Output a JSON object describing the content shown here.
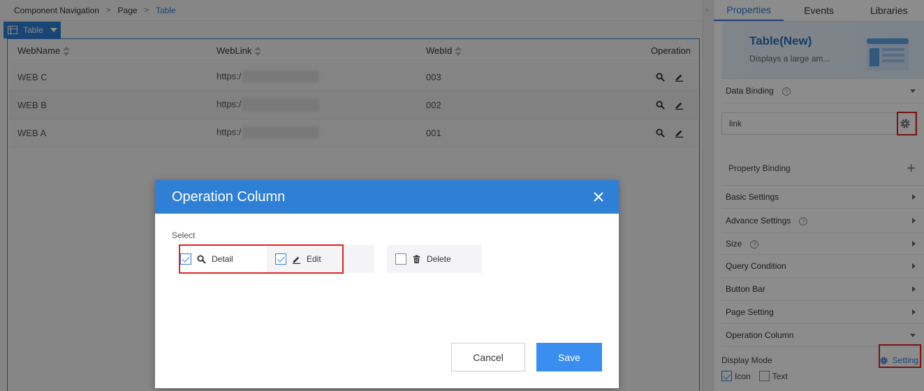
{
  "breadcrumb": {
    "items": [
      "Component Navigation",
      "Page"
    ],
    "current": "Table"
  },
  "canvas": {
    "tag_label": "Table",
    "columns": [
      "WebName",
      "WebLink",
      "WebId",
      "Operation"
    ],
    "rows": [
      {
        "name": "WEB C",
        "link": "https:/",
        "id": "003"
      },
      {
        "name": "WEB B",
        "link": "https:/",
        "id": "002"
      },
      {
        "name": "WEB A",
        "link": "https:/",
        "id": "001"
      }
    ]
  },
  "modal": {
    "title": "Operation Column",
    "select_label": "Select",
    "options": [
      {
        "label": "Detail",
        "checked": true,
        "icon": "search-icon"
      },
      {
        "label": "Edit",
        "checked": true,
        "icon": "edit-icon"
      },
      {
        "label": "Delete",
        "checked": false,
        "icon": "trash-icon"
      }
    ],
    "cancel_label": "Cancel",
    "save_label": "Save"
  },
  "panel": {
    "tabs": [
      "Properties",
      "Events",
      "Libraries"
    ],
    "active_tab": "Properties",
    "component_title": "Table(New)",
    "component_desc": "Displays a large am...",
    "data_binding_label": "Data Binding",
    "link_value": "link",
    "property_binding_label": "Property Binding",
    "sections": [
      "Basic Settings",
      "Advance Settings",
      "Size",
      "Query Condition",
      "Button Bar",
      "Page Setting",
      "Operation Column"
    ],
    "display_mode_label": "Display Mode",
    "setting_label": "Setting",
    "display_options": [
      {
        "label": "Icon",
        "checked": true
      },
      {
        "label": "Text",
        "checked": false
      }
    ]
  },
  "colors": {
    "accent": "#2f7fd6",
    "save_button": "#3a8ef0",
    "highlight": "#e02424"
  }
}
